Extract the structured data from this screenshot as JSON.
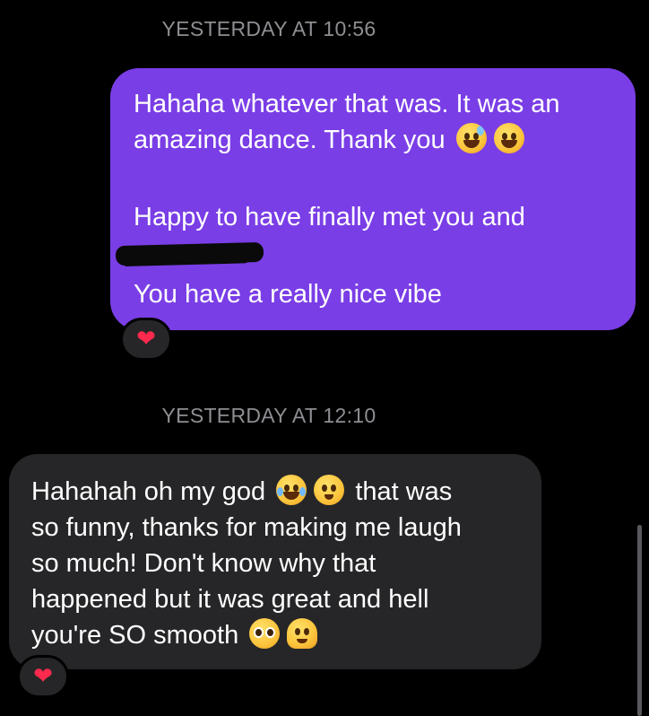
{
  "timestamps": {
    "first": "YESTERDAY AT 10:56",
    "second": "YESTERDAY AT 12:10"
  },
  "sent_message": {
    "line1": "Hahaha whatever that was. It was an",
    "line2": "amazing dance. Thank you",
    "line2_emojis": [
      "grinning-face-with-sweat-icon",
      "beaming-face-icon"
    ],
    "line3": "Happy to have finally met you and",
    "line4_redacted": true,
    "line5": "You have a really nice vibe",
    "reaction": "❤"
  },
  "received_message": {
    "line1_start": "Hahahah oh my god",
    "line1_emojis": [
      "face-with-tears-of-joy-icon",
      "drooling-face-icon"
    ],
    "line1_end": "that was",
    "line2": "so funny, thanks for making me laugh",
    "line3": "so much! Don't know why that",
    "line4": "happened but it was great and hell",
    "line5": "you're SO smooth",
    "line5_emojis": [
      "pleading-face-icon",
      "melting-face-icon"
    ],
    "reaction": "❤"
  },
  "colors": {
    "background": "#000000",
    "sent_bubble": "#7a3ee6",
    "received_bubble": "#262628",
    "timestamp_text": "#8e8e93",
    "heart": "#ff2a4d"
  }
}
